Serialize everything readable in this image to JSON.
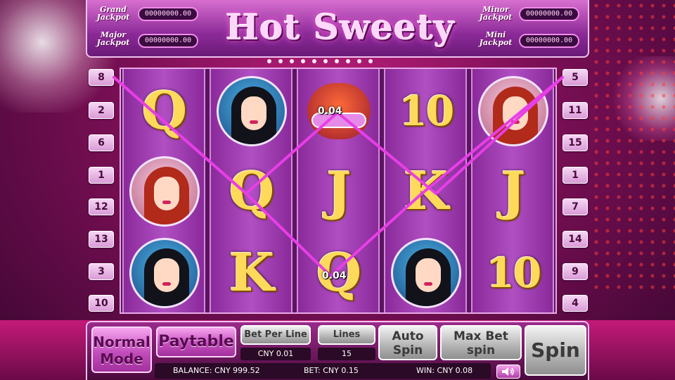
{
  "header": {
    "title": "Hot Sweety",
    "jackpots": {
      "grand": {
        "label_line1": "Grand",
        "label_line2": "Jackpot",
        "value": "00000000.00"
      },
      "major": {
        "label_line1": "Major",
        "label_line2": "Jackpot",
        "value": "00000000.00"
      },
      "minor": {
        "label_line1": "Minor",
        "label_line2": "Jackpot",
        "value": "00000000.00"
      },
      "mini": {
        "label_line1": "Mini",
        "label_line2": "Jackpot",
        "value": "00000000.00"
      }
    }
  },
  "line_buttons": {
    "left": [
      "8",
      "2",
      "6",
      "1",
      "12",
      "13",
      "3",
      "10"
    ],
    "right": [
      "5",
      "11",
      "15",
      "1",
      "7",
      "14",
      "9",
      "4"
    ]
  },
  "reels": [
    [
      "Q",
      "portrait-red",
      "portrait-dark"
    ],
    [
      "portrait-dark",
      "Q",
      "K"
    ],
    [
      "scatter",
      "J",
      "Q"
    ],
    [
      "10",
      "K",
      "portrait-dark"
    ],
    [
      "portrait-red",
      "J",
      "10"
    ]
  ],
  "wins": {
    "win_1": "0.04",
    "win_2": "0.04"
  },
  "controls": {
    "normal_mode_line1": "Normal",
    "normal_mode_line2": "Mode",
    "paytable": "Paytable",
    "bet_per_line_label": "Bet Per Line",
    "bet_per_line_value": "CNY 0.01",
    "lines_label": "Lines",
    "lines_value": "15",
    "auto_spin_line1": "Auto",
    "auto_spin_line2": "Spin",
    "max_bet_line1": "Max Bet",
    "max_bet_line2": "spin",
    "spin": "Spin",
    "balance": "BALANCE: CNY 999.52",
    "bet": "BET: CNY 0.15",
    "win": "WIN: CNY 0.08"
  },
  "colors": {
    "payline": "#e83ee6",
    "gold": "#ffd95a",
    "accent_pink": "#c34fbd"
  },
  "icons": {
    "sound": "speaker-icon"
  }
}
